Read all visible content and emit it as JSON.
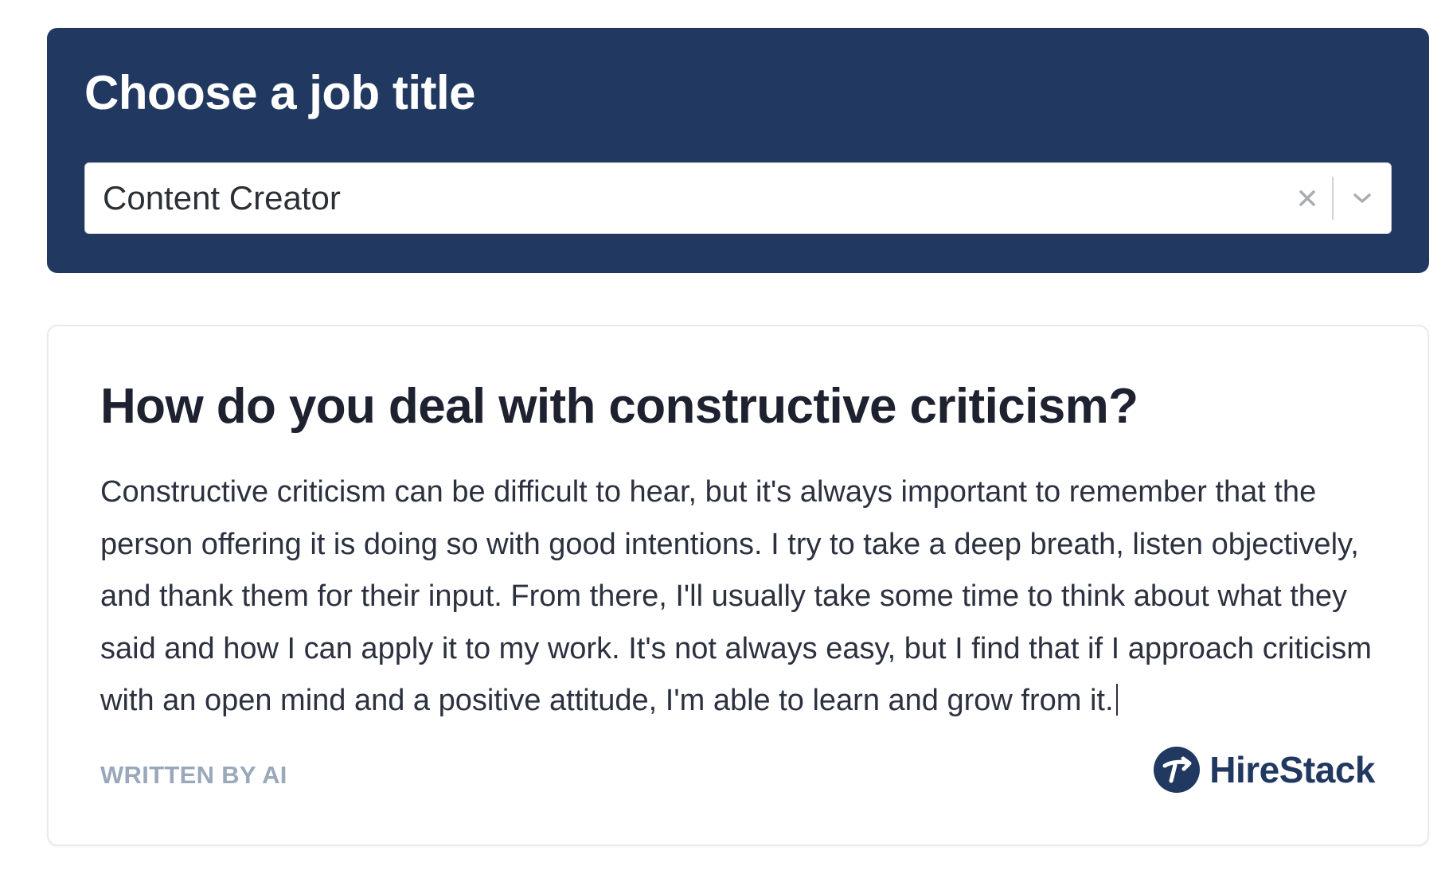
{
  "header": {
    "title": "Choose a job title"
  },
  "job_select": {
    "selected_value": "Content Creator",
    "clear_icon": "close-icon",
    "toggle_icon": "chevron-down-icon"
  },
  "card": {
    "question": "How do you deal with constructive criticism?",
    "answer": "Constructive criticism can be difficult to hear, but it's always important to remember that the person offering it is doing so with good intentions. I try to take a deep breath, listen objectively, and thank them for their input. From there, I'll usually take some time to think about what they said and how I can apply it to my work. It's not always easy, but I find that if I approach criticism with an open mind and a positive attitude, I'm able to learn and grow from it.",
    "written_by": "WRITTEN BY AI",
    "brand_name": "HireStack",
    "brand_logo_icon": "hirestack-logo-icon"
  },
  "colors": {
    "header_bg": "#213860",
    "brand": "#213860",
    "muted_label": "#9aa8bb"
  }
}
